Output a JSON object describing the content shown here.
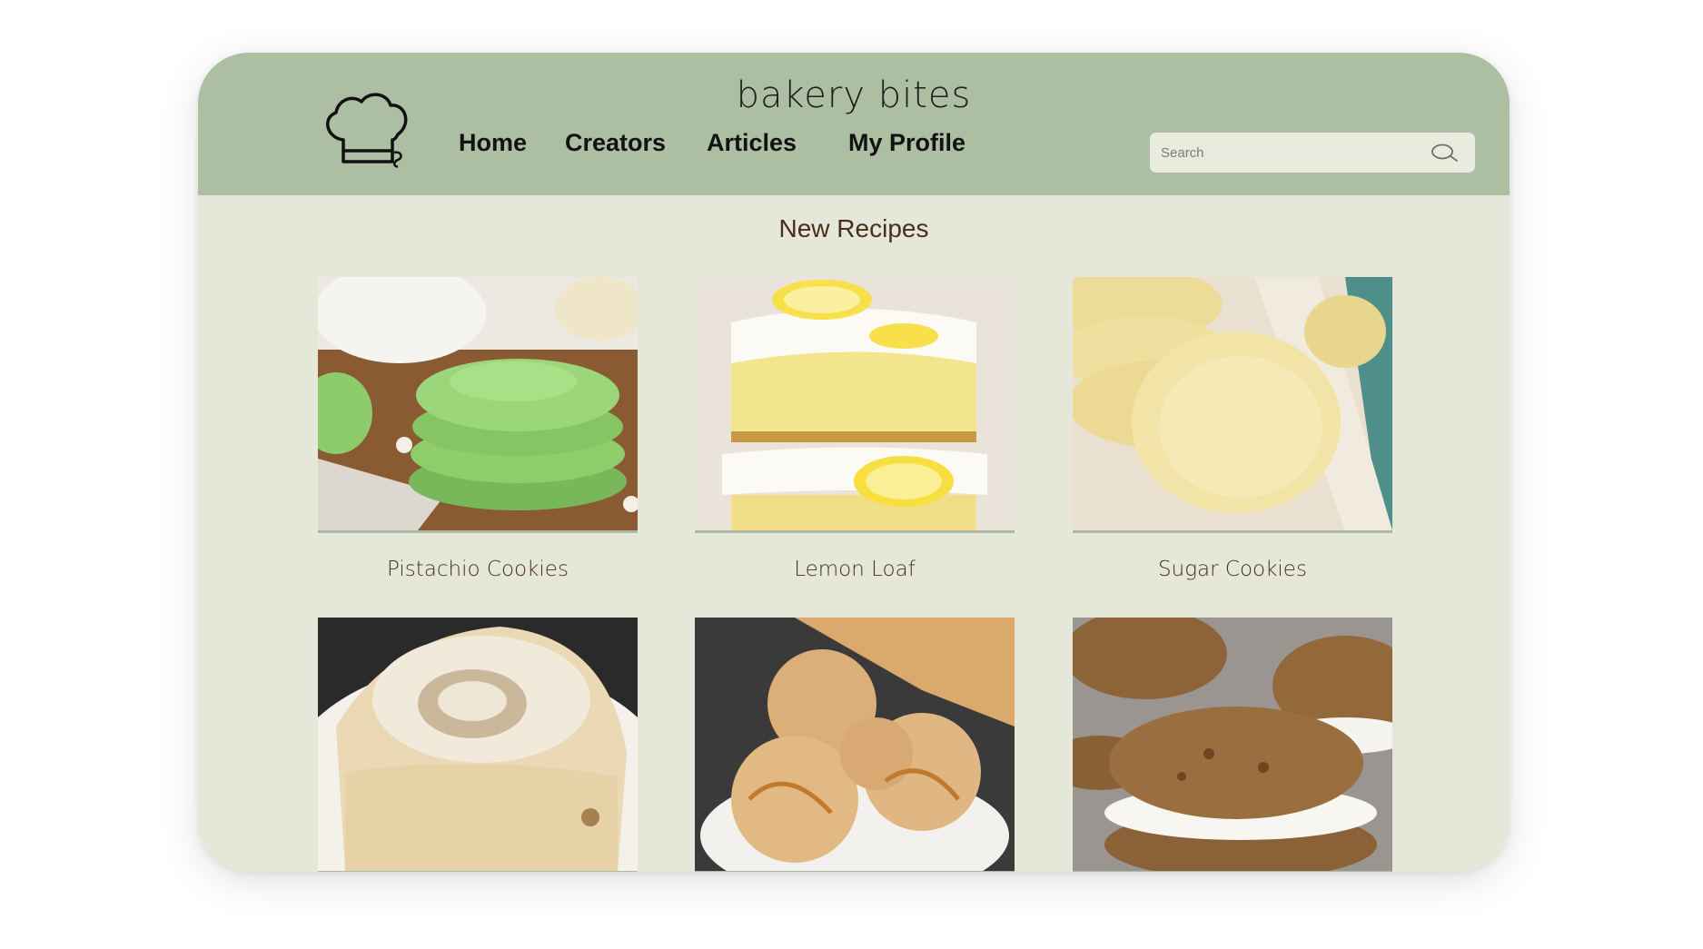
{
  "header": {
    "brand": "bakery bites",
    "nav": [
      {
        "label": "Home"
      },
      {
        "label": "Creators"
      },
      {
        "label": "Articles"
      },
      {
        "label": "My Profile"
      }
    ],
    "search": {
      "placeholder": "Search",
      "value": ""
    }
  },
  "main": {
    "section_title": "New Recipes",
    "recipes": [
      {
        "name": "Pistachio Cookies"
      },
      {
        "name": "Lemon Loaf"
      },
      {
        "name": "Sugar Cookies"
      },
      {
        "name": ""
      },
      {
        "name": ""
      },
      {
        "name": ""
      }
    ]
  },
  "colors": {
    "header_bg": "#acbfa2",
    "page_bg": "#e5e8d8",
    "title_text": "#4a2e1c"
  },
  "icons": [
    "chef-hat-icon",
    "search-icon"
  ]
}
